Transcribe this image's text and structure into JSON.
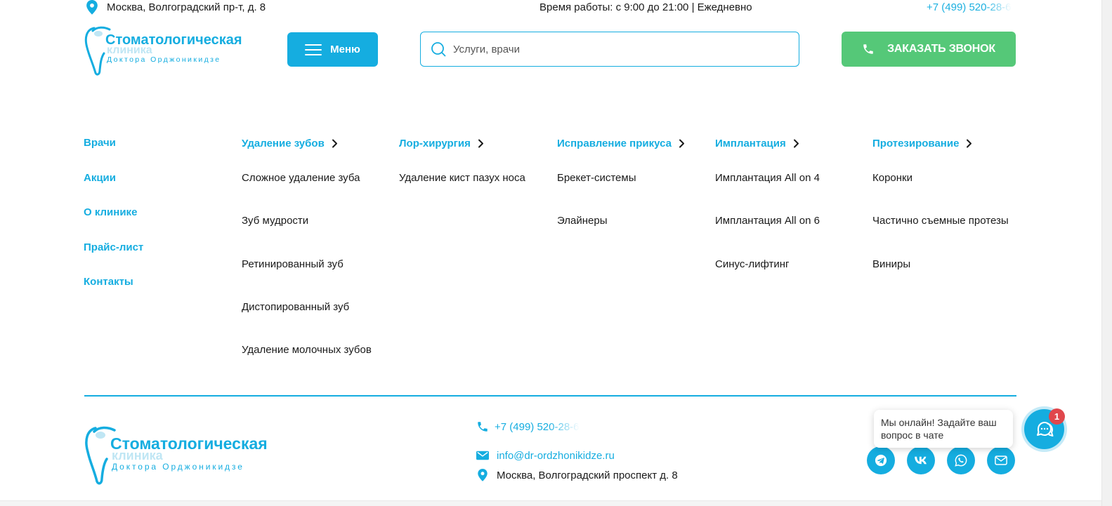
{
  "topbar": {
    "address": "Москва, Волгоградский пр-т, д. 8",
    "hours": "Время работы: с 9:00 до 21:00 | Ежедневно",
    "phone": "+7 (499) 520-28-6"
  },
  "logo": {
    "line1": "Стоматологическая",
    "line2": "клиника",
    "line3": "Доктора Орджоникидзе"
  },
  "header": {
    "menu_label": "Меню",
    "search_placeholder": "Услуги, врачи",
    "search_value": "",
    "call_label": "ЗАКАЗАТЬ ЗВОНОК"
  },
  "nav": {
    "side": [
      "Врачи",
      "Акции",
      "О клинике",
      "Прайс-лист",
      "Контакты"
    ],
    "columns": [
      {
        "title": "Удаление зубов",
        "items": [
          "Сложное удаление зуба",
          "Зуб мудрости",
          "Ретинированный зуб",
          "Дистопированный зуб",
          "Удаление молочных зубов"
        ]
      },
      {
        "title": "Лор-хирургия",
        "items": [
          "Удаление кист пазух носа"
        ]
      },
      {
        "title": "Исправление прикуса",
        "items": [
          "Брекет-системы",
          "Элайнеры"
        ]
      },
      {
        "title": "Имплантация",
        "items": [
          "Имплантация All on 4",
          "Имплантация All on 6",
          "Синус-лифтинг"
        ]
      },
      {
        "title": "Протезирование",
        "items": [
          "Коронки",
          "Частично съемные протезы",
          "Виниры"
        ]
      }
    ]
  },
  "footer": {
    "phone": "+7 (499) 520-28-6",
    "email": "info@dr-ordzhonikidze.ru",
    "address": "Москва, Волгоградский проспект д. 8",
    "socials": [
      "telegram-icon",
      "vk-icon",
      "whatsapp-icon",
      "mail-icon"
    ]
  },
  "chat": {
    "message": "Мы онлайн! Задайте ваш вопрос в чате",
    "badge": "1"
  },
  "colors": {
    "accent": "#15ade0",
    "call_button": "#55c878",
    "badge": "#e0474c"
  }
}
